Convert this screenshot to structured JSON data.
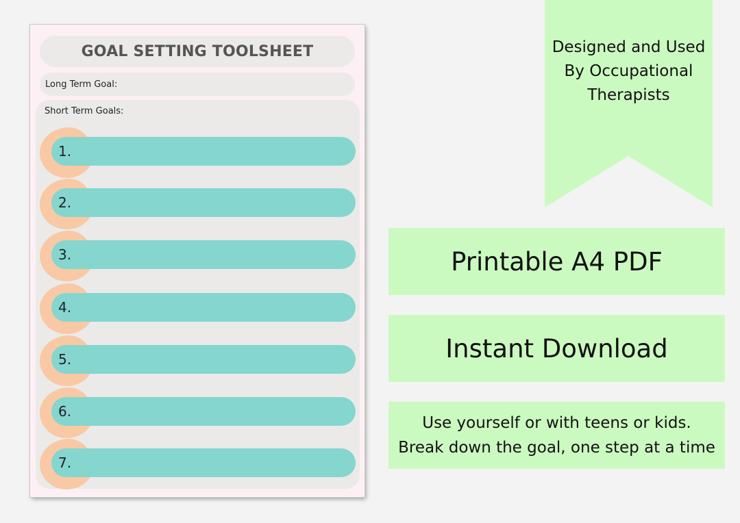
{
  "worksheet": {
    "title": "GOAL SETTING TOOLSHEET",
    "long_term_label": "Long Term Goal:",
    "short_term_label": "Short Term Goals:",
    "goals": [
      "1.",
      "2.",
      "3.",
      "4.",
      "5.",
      "6.",
      "7."
    ]
  },
  "ribbon": {
    "line1": "Designed and Used",
    "line2": "By Occupational",
    "line3": "Therapists"
  },
  "panels": {
    "format": "Printable A4 PDF",
    "delivery": "Instant Download",
    "usage_line1": "Use yourself or with teens or kids.",
    "usage_line2": "Break down the goal, one step at a time"
  },
  "colors": {
    "background": "#f3f3f3",
    "sheet": "#fdf0f5",
    "grey_bar": "#ebeae9",
    "teal_bar": "#84d6cf",
    "peach_blob": "#f8c9a4",
    "green_panel": "#cbfac0"
  }
}
